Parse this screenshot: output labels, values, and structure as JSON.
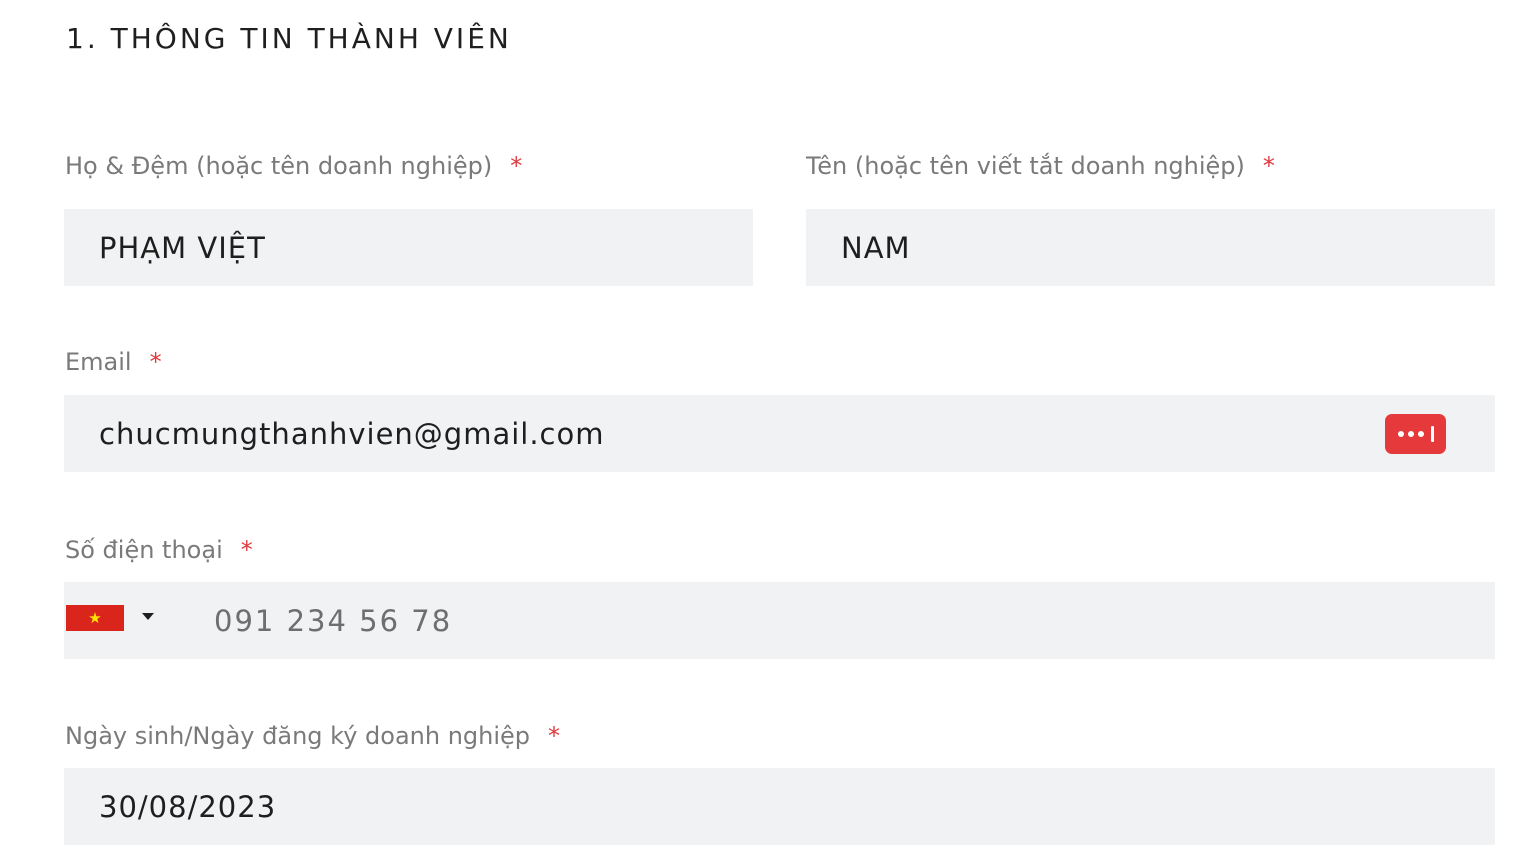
{
  "section": {
    "title": "1. THÔNG TIN THÀNH VIÊN"
  },
  "fields": {
    "last_name": {
      "label": "Họ & Đệm (hoặc tên doanh nghiệp)",
      "required_mark": "*",
      "value": "PHẠM VIỆT"
    },
    "first_name": {
      "label": "Tên (hoặc tên viết tắt doanh nghiệp)",
      "required_mark": "*",
      "value": "NAM"
    },
    "email": {
      "label": "Email",
      "required_mark": "*",
      "value": "chucmungthanhvien@gmail.com",
      "autofill_icon": "password-manager-icon"
    },
    "phone": {
      "label": "Số điện thoại",
      "required_mark": "*",
      "country_flag_icon": "vietnam-flag-icon",
      "dropdown_icon": "caret-down-icon",
      "value": "091 234 56 78"
    },
    "dob": {
      "label": "Ngày sinh/Ngày đăng ký doanh nghiệp",
      "required_mark": "*",
      "value": "30/08/2023"
    }
  },
  "colors": {
    "required": "#e0393e",
    "field_bg": "#f1f2f3",
    "label": "#7a7a7a",
    "badge": "#e5393c",
    "flag_red": "#da251d",
    "flag_star": "#ffe300"
  }
}
